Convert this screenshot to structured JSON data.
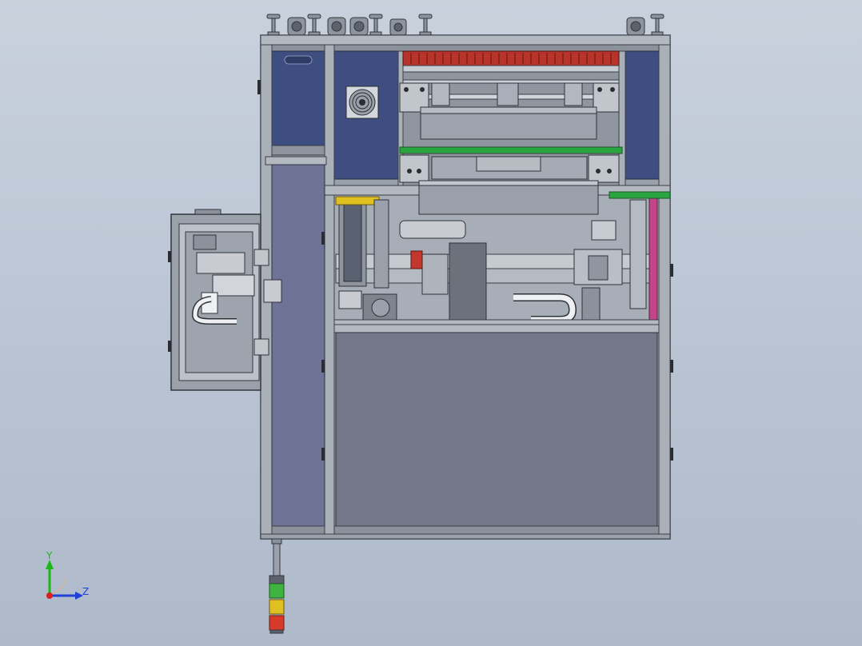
{
  "view": {
    "type": "CAD assembly front view",
    "background_top": "#c9d1dd",
    "background_bottom": "#aeb9ca"
  },
  "colors": {
    "frame": "#9aa1ab",
    "frame_dark": "#4b5058",
    "panel_blue": "#3e4e80",
    "panel_blue_dark": "#2f3c66",
    "side_panel": "#6f7396",
    "lower_panel": "#737889",
    "rail_green": "#2aa640",
    "heater_red": "#b8342b",
    "magenta_rail": "#c4468a",
    "tower_green": "#3fb33f",
    "tower_yellow": "#e0c020",
    "tower_red": "#d83a2a"
  },
  "triad": {
    "y_label": "Y",
    "z_label": "Z",
    "y_color": "#18b818",
    "z_color": "#2040d8",
    "origin_color": "#d82020"
  },
  "signal_tower": {
    "segments": [
      "green",
      "yellow",
      "red"
    ]
  }
}
